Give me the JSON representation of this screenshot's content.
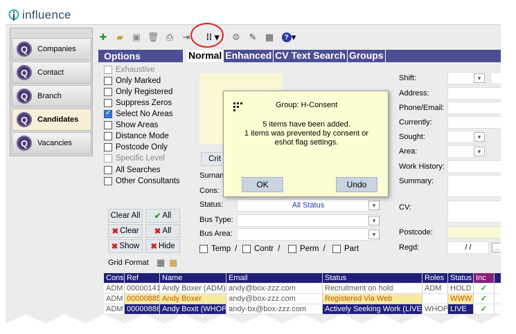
{
  "app": {
    "name": "influence"
  },
  "sidebar": {
    "items": [
      {
        "label": "Companies"
      },
      {
        "label": "Contact"
      },
      {
        "label": "Branch"
      },
      {
        "label": "Candidates"
      },
      {
        "label": "Vacancies"
      }
    ]
  },
  "options": {
    "title": "Options",
    "items": [
      {
        "label": "Exhaustive"
      },
      {
        "label": "Only Marked"
      },
      {
        "label": "Only Registered"
      },
      {
        "label": "Suppress Zeros"
      },
      {
        "label": "Select No Areas"
      },
      {
        "label": "Show Areas"
      },
      {
        "label": "Distance Mode"
      },
      {
        "label": "Postcode Only"
      },
      {
        "label": "Specific Level"
      },
      {
        "label": "All Searches"
      },
      {
        "label": "Other Consultants"
      }
    ],
    "buttons": {
      "clear_all": "Clear All",
      "all": "All",
      "clear": "Clear",
      "all2": "All",
      "show": "Show",
      "hide": "Hide"
    },
    "grid_format": "Grid Format"
  },
  "tabs": [
    {
      "label": "Normal"
    },
    {
      "label": "Enhanced"
    },
    {
      "label": "CV Text Search"
    },
    {
      "label": "Groups"
    }
  ],
  "form": {
    "crit_label": "Crit",
    "surname": "Surnam",
    "cons": "Cons:",
    "status": "Status:",
    "status_value": "All Status",
    "bus_type": "Bus Type:",
    "bus_area": "Bus Area:",
    "temp": "Temp",
    "contr": "Contr",
    "perm": "Perm",
    "part": "Part",
    "shift": "Shift:",
    "address": "Address:",
    "phone": "Phone/Email:",
    "currently": "Currently:",
    "sought": "Sought:",
    "area": "Area:",
    "work_history": "Work History:",
    "summary": "Summary:",
    "cv": "CV:",
    "postcode": "Postcode:",
    "regd": "Regd:",
    "regd_value": "/   /"
  },
  "dialog": {
    "title": "Group: H-Consent",
    "line1": "5 items have been added.",
    "line2": "1 items was prevented by consent or",
    "line3": "eshot flag settings.",
    "ok": "OK",
    "undo": "Undo"
  },
  "grid": {
    "headers": [
      "Cons",
      "Ref",
      "Name",
      "Email",
      "Status",
      "Roles",
      "Status",
      "Inc"
    ],
    "rows": [
      [
        "ADM",
        "00000141",
        "Andy Boxer (ADM)",
        "andy@box-zzz.com",
        "Recruitment on hold",
        "ADM",
        "HOLD",
        "✓"
      ],
      [
        "ADM",
        "00000885",
        "Andy Boxer",
        "andy@box-zzz.com",
        "Registered Via Web",
        "",
        "WWW",
        "✓"
      ],
      [
        "ADM",
        "00000888",
        "Andy Boxit (WHOP)",
        "andy-bx@box-zzz.com",
        "Actively Seeking Work (LIVE)",
        "WHOP",
        "LIVE",
        "✓"
      ]
    ]
  }
}
